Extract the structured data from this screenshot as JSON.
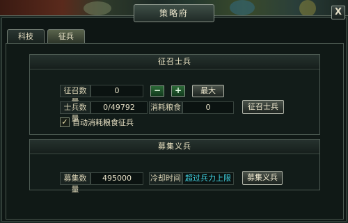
{
  "window": {
    "title": "策略府",
    "close_label": "X"
  },
  "tabs": [
    {
      "label": "科技",
      "active": false
    },
    {
      "label": "征兵",
      "active": true
    }
  ],
  "recruit_soldiers": {
    "heading": "征召士兵",
    "quantity_label": "征召数量",
    "quantity_value": "0",
    "decrease_label": "−",
    "increase_label": "+",
    "max_label": "最大",
    "soldier_count_label": "士兵数量",
    "soldier_count_value": "0/49792",
    "grain_cost_label": "消耗粮食",
    "grain_cost_value": "0",
    "recruit_button": "征召士兵",
    "auto_checkbox_label": "自动消耗粮食征兵",
    "auto_checked": true
  },
  "volunteers": {
    "heading": "募集义兵",
    "count_label": "募集数量",
    "count_value": "495000",
    "cooldown_label": "冷却时间",
    "cooldown_value": "超过兵力上限",
    "recruit_button": "募集义兵"
  },
  "colors": {
    "accent_cyan": "#3fd1e0",
    "panel_bg": "#0e1614",
    "border": "#4e5c54"
  }
}
